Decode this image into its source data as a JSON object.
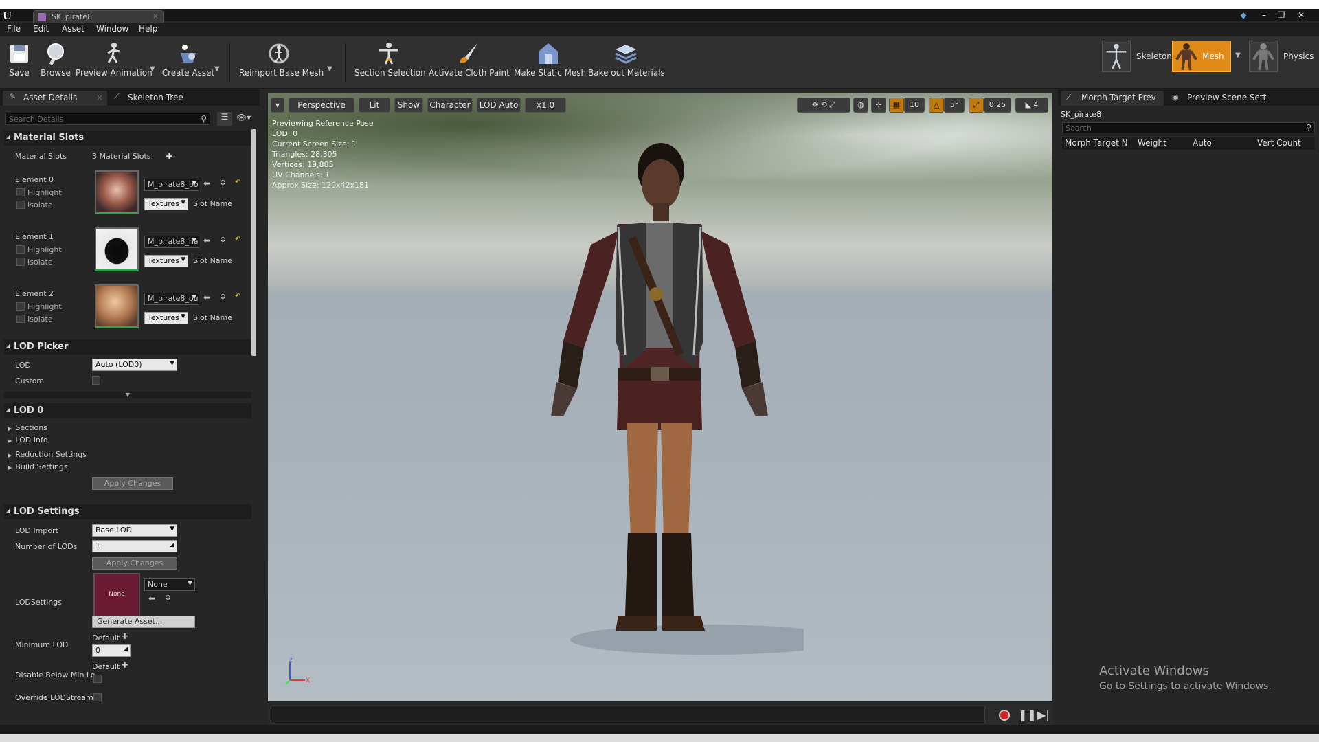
{
  "window": {
    "doc_tab": "SK_pirate8",
    "controls": [
      "–",
      "❐",
      "✕"
    ]
  },
  "menu": [
    "File",
    "Edit",
    "Asset",
    "Window",
    "Help"
  ],
  "toolbar": {
    "buttons": [
      "Save",
      "Browse",
      "Preview Animation",
      "Create Asset",
      "Reimport Base Mesh",
      "Section Selection",
      "Activate Cloth Paint",
      "Make Static Mesh",
      "Bake out Materials"
    ],
    "modes": [
      "Skeleton",
      "Mesh",
      "Physics"
    ]
  },
  "left_panel": {
    "tabs": [
      "Asset Details",
      "Skeleton Tree"
    ],
    "search_placeholder": "Search Details",
    "material_slots": {
      "title": "Material Slots",
      "label": "Material Slots",
      "count": "3 Material Slots",
      "elements": [
        {
          "name": "Element 0",
          "material": "M_pirate8_bo",
          "textures": "Textures",
          "slot": "Slot Name"
        },
        {
          "name": "Element 1",
          "material": "M_pirate8_ha",
          "textures": "Textures",
          "slot": "Slot Name"
        },
        {
          "name": "Element 2",
          "material": "M_pirate8_ou",
          "textures": "Textures",
          "slot": "Slot Name"
        }
      ],
      "highlight": "Highlight",
      "isolate": "Isolate"
    },
    "lod_picker": {
      "title": "LOD Picker",
      "lod_label": "LOD",
      "lod_value": "Auto (LOD0)",
      "custom_label": "Custom"
    },
    "lod0": {
      "title": "LOD 0",
      "items": [
        "Sections",
        "LOD Info",
        "Reduction Settings",
        "Build Settings"
      ],
      "apply": "Apply Changes"
    },
    "lod_settings": {
      "title": "LOD Settings",
      "lod_import_label": "LOD Import",
      "lod_import_value": "Base LOD",
      "num_lods_label": "Number of LODs",
      "num_lods_value": "1",
      "apply": "Apply Changes",
      "lodsettings_label": "LODSettings",
      "thumb_text": "None",
      "none_value": "None",
      "generate": "Generate Asset...",
      "min_lod_label": "Minimum LOD",
      "default1": "Default",
      "min_lod_value": "0",
      "disable_below_label": "Disable Below Min Lo",
      "default2": "Default",
      "override_label": "Override LODStreami"
    }
  },
  "viewport": {
    "buttons": [
      "Perspective",
      "Lit",
      "Show",
      "Character",
      "LOD Auto",
      "x1.0"
    ],
    "right_values": [
      "10",
      "5°",
      "0.25",
      "4"
    ],
    "info": [
      "Previewing Reference Pose",
      "LOD: 0",
      "Current Screen Size: 1",
      "Triangles: 28,305",
      "Vertices: 19,885",
      "UV Channels: 1",
      "Approx Size: 120x42x181"
    ],
    "axis_z": "Z",
    "axis_x": "X"
  },
  "right_panel": {
    "tabs": [
      "Morph Target Prev",
      "Preview Scene Sett"
    ],
    "asset_name": "SK_pirate8",
    "search_placeholder": "Search",
    "columns": [
      "Morph Target N",
      "Weight",
      "Auto",
      "Vert Count"
    ]
  },
  "watermark": {
    "line1": "Activate Windows",
    "line2": "Go to Settings to activate Windows."
  },
  "colors": {
    "accent_orange": "#e08a1a",
    "bg": "#262626",
    "toolbar": "#303030"
  }
}
